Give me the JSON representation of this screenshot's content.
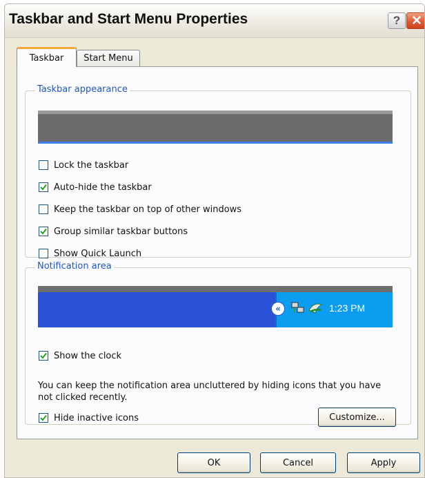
{
  "window": {
    "title": "Taskbar and Start Menu Properties",
    "help_label": "?",
    "close_label": "✕"
  },
  "tabs": [
    {
      "label": "Taskbar",
      "active": true
    },
    {
      "label": "Start Menu",
      "active": false
    }
  ],
  "taskbar_appearance": {
    "legend": "Taskbar appearance",
    "options": [
      {
        "label": "Lock the taskbar",
        "checked": false
      },
      {
        "label": "Auto-hide the taskbar",
        "checked": true
      },
      {
        "label": "Keep the taskbar on top of other windows",
        "checked": false
      },
      {
        "label": "Group similar taskbar buttons",
        "checked": true
      },
      {
        "label": "Show Quick Launch",
        "checked": false
      }
    ]
  },
  "notification_area": {
    "legend": "Notification area",
    "clock_time": "1:23 PM",
    "show_clock": {
      "label": "Show the clock",
      "checked": true
    },
    "description": "You can keep the notification area uncluttered by hiding icons that you have not clicked recently.",
    "hide_inactive": {
      "label": "Hide inactive icons",
      "checked": true
    },
    "customize_label": "Customize..."
  },
  "buttons": {
    "ok": "OK",
    "cancel": "Cancel",
    "apply": "Apply"
  },
  "colors": {
    "accent": "#1f56c8",
    "window_bg": "#ece9d8",
    "taskbar_blue": "#2a52d6",
    "tray_blue": "#0c9df0",
    "check_green": "#21a121"
  }
}
